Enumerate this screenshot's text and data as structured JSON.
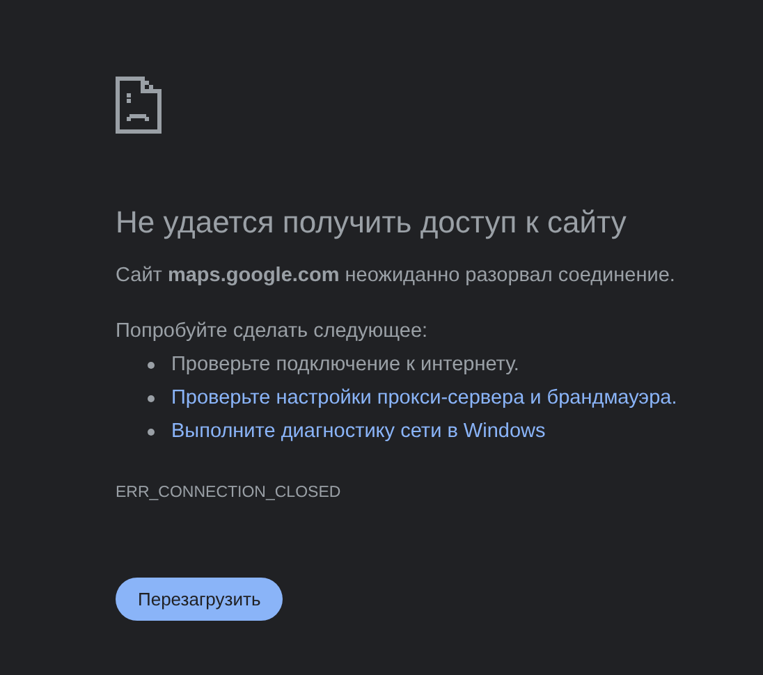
{
  "heading": "Не удается получить доступ к сайту",
  "description": "Сайт **maps.google.com** неожиданно разорвал соединение.",
  "suggestions_title": "Попробуйте сделать следующее:",
  "suggestions": [
    {
      "text": "Проверьте подключение к интернету.",
      "kind": "text"
    },
    {
      "text": "Проверьте настройки прокси-сервера и брандмауэра.",
      "kind": "link"
    },
    {
      "text": "Выполните диагностику сети в Windows",
      "kind": "link"
    }
  ],
  "error_code": "ERR_CONNECTION_CLOSED",
  "reload_button": "Перезагрузить"
}
